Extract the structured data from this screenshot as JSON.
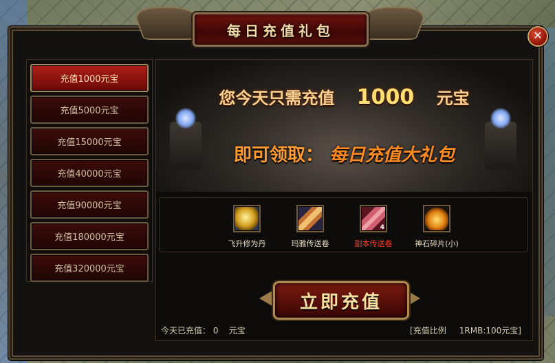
{
  "window": {
    "title": "每日充值礼包",
    "close_symbol": "✕"
  },
  "tiers": [
    {
      "label": "充值1000元宝",
      "active": true
    },
    {
      "label": "充值5000元宝",
      "active": false
    },
    {
      "label": "充值15000元宝",
      "active": false
    },
    {
      "label": "充值40000元宝",
      "active": false
    },
    {
      "label": "充值90000元宝",
      "active": false
    },
    {
      "label": "充值180000元宝",
      "active": false
    },
    {
      "label": "充值320000元宝",
      "active": false
    }
  ],
  "banner": {
    "line1_prefix": "您今天只需充值",
    "amount": "1000",
    "line1_suffix": "元宝",
    "line2_prefix": "即可领取：",
    "line2_reward": "每日充值大礼包"
  },
  "rewards": [
    {
      "name": "飞升修为丹",
      "icon": "golden-orb-icon",
      "color": "#e8dcc2"
    },
    {
      "name": "玛雅传送卷",
      "icon": "scroll-icon",
      "color": "#e8dcc2"
    },
    {
      "name": "副本传送卷",
      "icon": "red-scroll-icon",
      "count": "4",
      "color": "#ff3b2b"
    },
    {
      "name": "神石碎片(小)",
      "icon": "gem-shard-icon",
      "color": "#e8dcc2"
    }
  ],
  "recharge_button": "立即充值",
  "footer": {
    "today_label": "今天已充值：",
    "today_value": "0",
    "today_unit": "元宝",
    "ratio_label": "[充值比例",
    "ratio_value": "1RMB:100元宝]"
  }
}
